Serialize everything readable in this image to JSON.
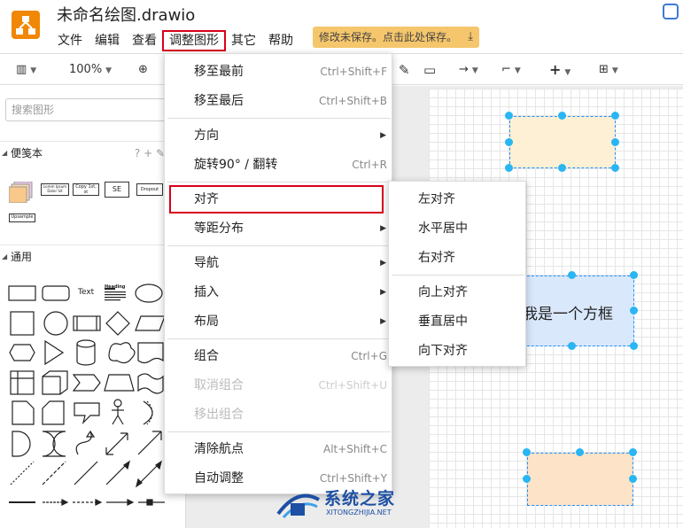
{
  "app": {
    "title": "未命名绘图.drawio"
  },
  "menubar": {
    "items": [
      "文件",
      "编辑",
      "查看",
      "调整图形",
      "其它",
      "帮助"
    ],
    "active": "调整图形"
  },
  "save_notice": {
    "text": "修改未保存。点击此处保存。"
  },
  "toolbar": {
    "zoom": "100%"
  },
  "sidebar": {
    "search_placeholder": "搜索图形",
    "scratchpad": {
      "label": "便笺本",
      "tools": "? + ✎"
    },
    "scratch_items": [
      "Lorem Ipsum Dolor Sit",
      "Copy 1st, st",
      "SE",
      "Dropout",
      "Upsample"
    ],
    "general": {
      "label": "通用"
    },
    "shape_labels": {
      "text": "Text",
      "heading": "Heading"
    }
  },
  "arrange_menu": {
    "items": [
      {
        "label": "移至最前",
        "shortcut": "Ctrl+Shift+F"
      },
      {
        "label": "移至最后",
        "shortcut": "Ctrl+Shift+B"
      },
      {
        "label": "方向",
        "submenu": true
      },
      {
        "label": "旋转90° / 翻转",
        "shortcut": "Ctrl+R"
      },
      {
        "label": "对齐",
        "submenu": true,
        "highlighted": true
      },
      {
        "label": "等距分布",
        "submenu": true
      },
      {
        "label": "导航",
        "submenu": true
      },
      {
        "label": "插入",
        "submenu": true
      },
      {
        "label": "布局",
        "submenu": true
      },
      {
        "label": "组合",
        "shortcut": "Ctrl+G"
      },
      {
        "label": "取消组合",
        "shortcut": "Ctrl+Shift+U",
        "disabled": true
      },
      {
        "label": "移出组合",
        "disabled": true
      },
      {
        "label": "清除航点",
        "shortcut": "Alt+Shift+C"
      },
      {
        "label": "自动调整",
        "shortcut": "Ctrl+Shift+Y"
      }
    ]
  },
  "align_submenu": {
    "items": [
      "左对齐",
      "水平居中",
      "右对齐",
      "向上对齐",
      "垂直居中",
      "向下对齐"
    ]
  },
  "canvas": {
    "box_label": "我是一个方框"
  },
  "watermark": {
    "title": "系统之家",
    "sub": "XITONGZHIJIA.NET"
  },
  "colors": {
    "accent": "#f08705",
    "highlight": "#d9001b",
    "handle": "#29b6f2"
  }
}
